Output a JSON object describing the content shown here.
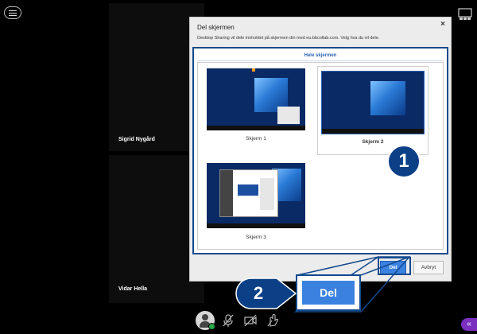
{
  "participants": [
    {
      "name": "Sigrid Nygård"
    },
    {
      "name": "Vidar Hella"
    }
  ],
  "dialog": {
    "title": "Del skjermen",
    "description": "Desktop Sharing vil dele innholdet på skjermen din med eu.bbcollab.com. Velg hva du vil dele.",
    "tab_label": "Hele skjermen",
    "screens": [
      {
        "label": "Skjerm 1",
        "selected": false
      },
      {
        "label": "Skjerm 2",
        "selected": true
      },
      {
        "label": "Skjerm 3",
        "selected": false
      }
    ],
    "share_button": "Del",
    "cancel_button": "Avbryt"
  },
  "callouts": {
    "one": "1",
    "two": "2",
    "zoom_label": "Del"
  },
  "icons": [
    "menu-icon",
    "layout-icon",
    "close-icon",
    "avatar-icon",
    "microphone-off-icon",
    "camera-off-icon",
    "raise-hand-icon",
    "chevron-left-icon"
  ],
  "colors": {
    "accent": "#3b82e0",
    "callout": "#0b3f86",
    "status_green": "#2aa84a",
    "collab_purple": "#7b2fbf"
  }
}
